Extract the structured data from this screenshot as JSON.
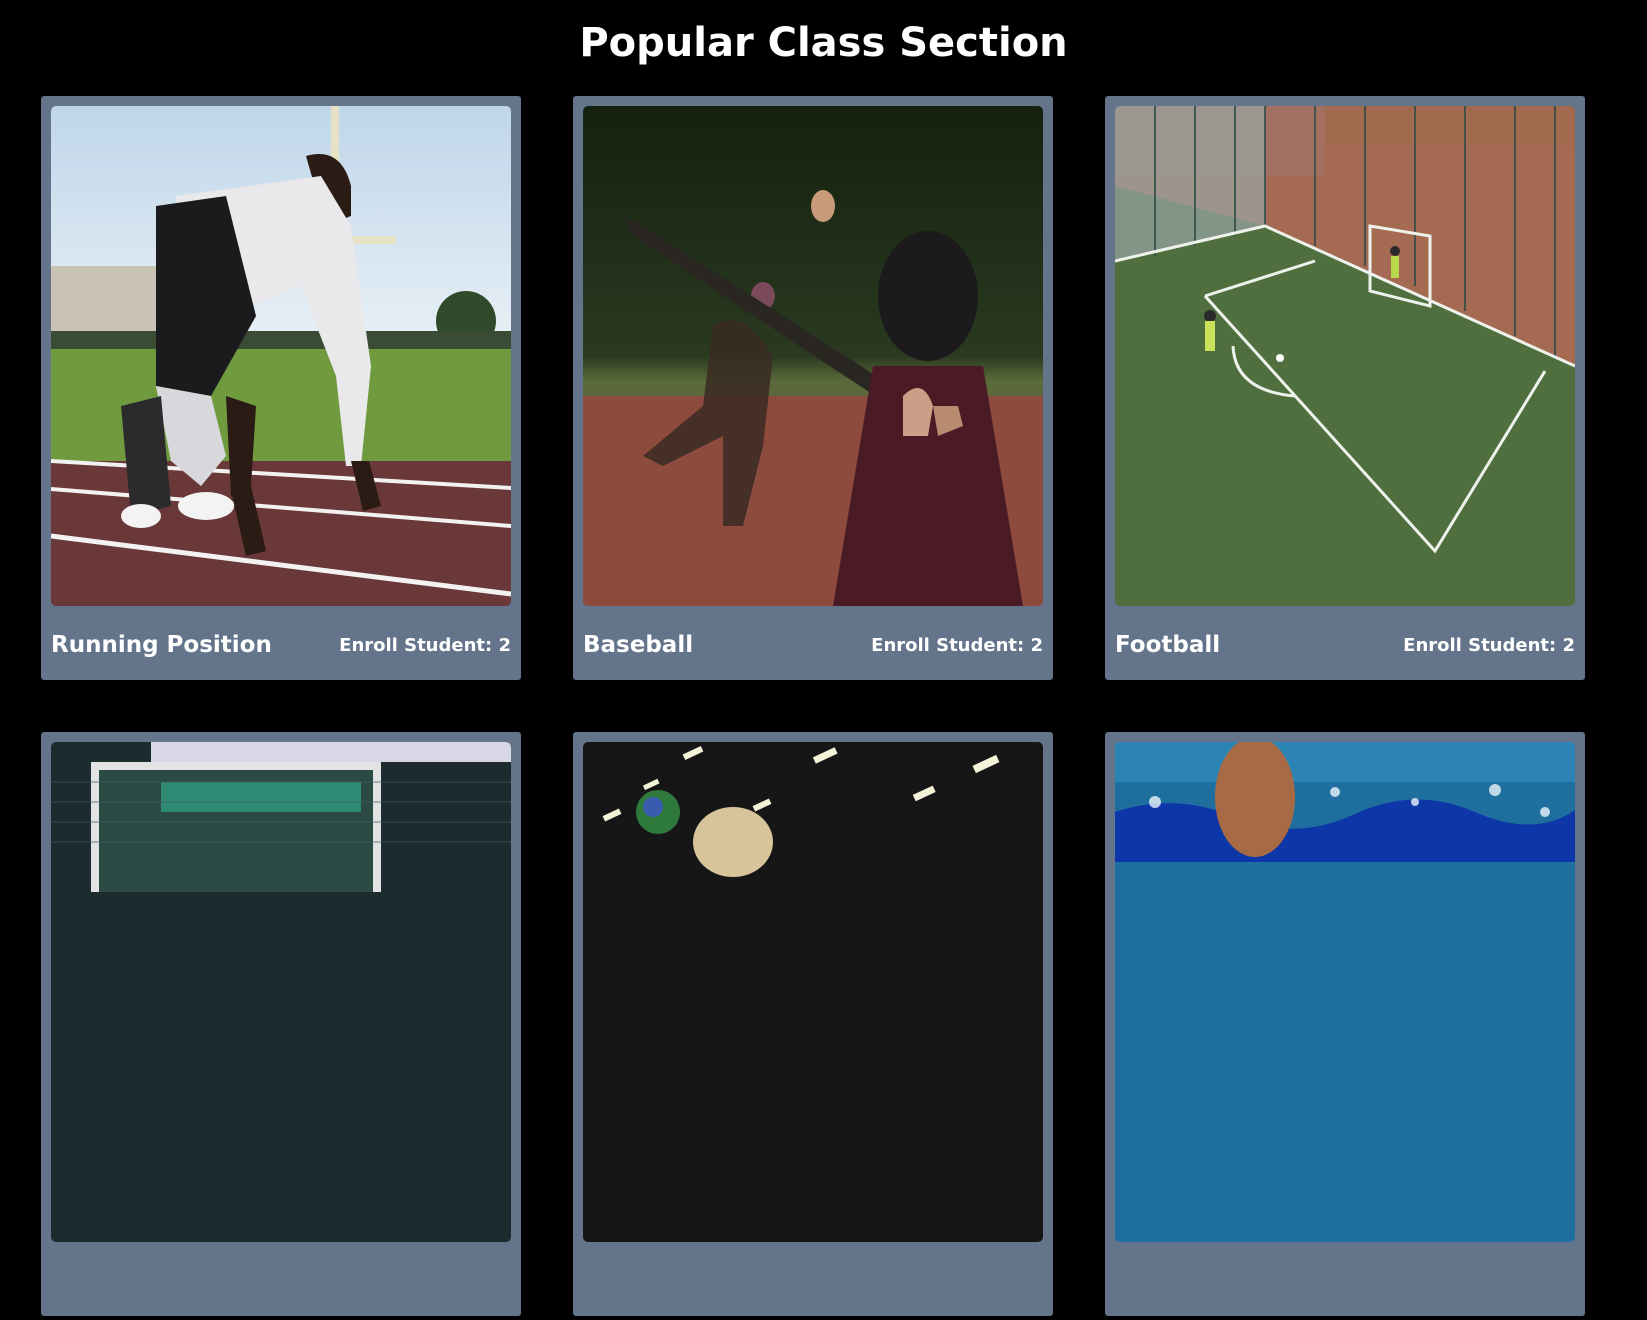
{
  "page": {
    "title": "Popular Class Section"
  },
  "classes": [
    {
      "name": "Running Position",
      "enroll_label": "Enroll Student: 2",
      "image": "sprinter-at-starting-line-photo"
    },
    {
      "name": "Baseball",
      "enroll_label": "Enroll Student: 2",
      "image": "child-batter-with-helmet-photo"
    },
    {
      "name": "Football",
      "enroll_label": "Enroll Student: 2",
      "image": "caged-football-pitch-photo"
    },
    {
      "name": "",
      "enroll_label": "",
      "image": "goal-net-photo"
    },
    {
      "name": "",
      "enroll_label": "",
      "image": "indoor-ball-player-photo"
    },
    {
      "name": "",
      "enroll_label": "",
      "image": "swimmer-in-pool-photo"
    }
  ],
  "colors": {
    "background": "#000000",
    "card": "#64748b",
    "text": "#ffffff"
  }
}
